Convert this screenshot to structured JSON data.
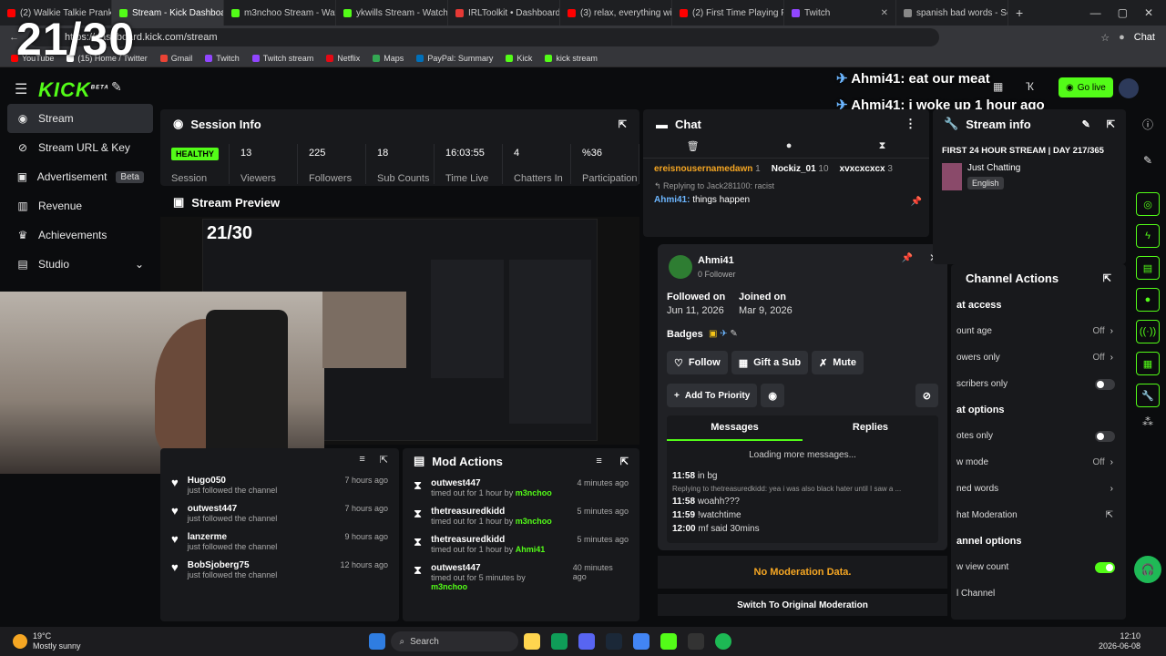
{
  "browser": {
    "tabs": [
      {
        "title": "(2) Walkie Talkie Prank",
        "color": "#ff0000"
      },
      {
        "title": "Stream - Kick Dashboard",
        "color": "#53fc18",
        "active": true
      },
      {
        "title": "m3nchoo Stream - Wat",
        "color": "#53fc18"
      },
      {
        "title": "ykwills Stream - Watch",
        "color": "#53fc18"
      },
      {
        "title": "IRLToolkit • Dashboard",
        "color": "#e53935"
      },
      {
        "title": "(3) relax, everything wil",
        "color": "#ff0000"
      },
      {
        "title": "(2) First Time Playing F",
        "color": "#ff0000"
      },
      {
        "title": "Twitch",
        "color": "#9146ff"
      },
      {
        "title": "spanish bad words - Se",
        "color": "#888888"
      }
    ],
    "url": "https://dashboard.kick.com/stream",
    "chat_label": "Chat",
    "bookmarks": [
      {
        "label": "YouTube",
        "color": "#ff0000"
      },
      {
        "label": "(15) Home / Twitter",
        "color": "#ffffff"
      },
      {
        "label": "Gmail",
        "color": "#ea4335"
      },
      {
        "label": "Twitch",
        "color": "#9146ff"
      },
      {
        "label": "Twitch stream",
        "color": "#9146ff"
      },
      {
        "label": "Netflix",
        "color": "#e50914"
      },
      {
        "label": "Maps",
        "color": "#34a853"
      },
      {
        "label": "PayPal: Summary",
        "color": "#0070ba"
      },
      {
        "label": "Kick",
        "color": "#53fc18"
      },
      {
        "label": "kick stream",
        "color": "#53fc18"
      }
    ]
  },
  "overlay": {
    "counter": "21/30",
    "chat1": "Ahmi41: eat our meat",
    "chat2": "Ahmi41: i woke up 1 hour ago",
    "go_live": "Go live",
    "preview_counter": "21/30"
  },
  "sidebar": {
    "logo": "KICK",
    "logo_badge": "BETA",
    "items": [
      {
        "label": "Stream",
        "icon": "stream-icon",
        "active": true
      },
      {
        "label": "Stream URL & Key",
        "icon": "link-icon"
      },
      {
        "label": "Advertisement",
        "icon": "ad-icon",
        "badge": "Beta"
      },
      {
        "label": "Revenue",
        "icon": "revenue-icon"
      },
      {
        "label": "Achievements",
        "icon": "trophy-icon"
      },
      {
        "label": "Studio",
        "icon": "studio-icon"
      }
    ]
  },
  "session": {
    "title": "Session Info",
    "status": "HEALTHY",
    "status_label": "Session",
    "stats": [
      {
        "value": "13",
        "label": "Viewers"
      },
      {
        "value": "225",
        "label": "Followers"
      },
      {
        "value": "18",
        "label": "Sub Counts"
      },
      {
        "value": "16:03:55",
        "label": "Time Live"
      },
      {
        "value": "4",
        "label": "Chatters In"
      },
      {
        "value": "%36",
        "label": "Participation"
      }
    ]
  },
  "preview": {
    "title": "Stream Preview"
  },
  "activity": [
    {
      "name": "Hugo050",
      "action": "just followed the channel",
      "time": "7 hours ago"
    },
    {
      "name": "outwest447",
      "action": "just followed the channel",
      "time": "7 hours ago"
    },
    {
      "name": "lanzerme",
      "action": "just followed the channel",
      "time": "9 hours ago"
    },
    {
      "name": "BobSjoberg75",
      "action": "just followed the channel",
      "time": "12 hours ago"
    }
  ],
  "mod_actions": {
    "title": "Mod Actions",
    "items": [
      {
        "name": "outwest447",
        "action": "timed out for 1 hour by",
        "by": "m3nchoo",
        "time": "4 minutes ago"
      },
      {
        "name": "thetreasuredkidd",
        "action": "timed out for 1 hour by",
        "by": "m3nchoo",
        "time": "5 minutes ago"
      },
      {
        "name": "thetreasuredkidd",
        "action": "timed out for 1 hour by",
        "by": "Ahmi41",
        "time": "5 minutes ago"
      },
      {
        "name": "outwest447",
        "action": "timed out for 5 minutes by",
        "by": "m3nchoo",
        "time": "40 minutes ago"
      }
    ]
  },
  "chat": {
    "title": "Chat",
    "top_chatters": [
      {
        "name": "ereisnousernamedawn",
        "count": "1"
      },
      {
        "name": "Nockiz_01",
        "count": "10"
      },
      {
        "name": "xvxcxcxcx",
        "count": "3"
      }
    ],
    "reply_line": "Replying to Jack281100: racist",
    "reply_line2": "Replying to Jack281100: racist",
    "message_user": "Ahmi41:",
    "message_text": "things happen",
    "partial_user": "Jack281100: racist"
  },
  "popup": {
    "username": "Ahmi41",
    "followers": "0 Follower",
    "followed_label": "Followed on",
    "followed_date": "Jun 11, 2026",
    "joined_label": "Joined on",
    "joined_date": "Mar 9, 2026",
    "badges_label": "Badges",
    "follow": "Follow",
    "gift": "Gift a Sub",
    "mute": "Mute",
    "priority": "Add To Priority",
    "tab_messages": "Messages",
    "tab_replies": "Replies",
    "loading": "Loading more messages...",
    "messages": [
      {
        "time": "11:58",
        "text": "in bg"
      },
      {
        "time": "",
        "text": "Replying to thetreasuredkidd: yea i was also black hater until I saw a ..."
      },
      {
        "time": "11:58",
        "text": "woahh???"
      },
      {
        "time": "11:59",
        "text": "!watchtime"
      },
      {
        "time": "12:00",
        "text": "mf said 30mins"
      }
    ],
    "no_mod": "No Moderation Data.",
    "switch": "Switch To Original Moderation"
  },
  "stream_info": {
    "title": "Stream info",
    "stream_title": "FIRST 24 HOUR STREAM | DAY 217/365",
    "category": "Just Chatting",
    "language": "English"
  },
  "channel_actions": {
    "title": "Channel Actions",
    "rows": [
      {
        "type": "header",
        "label": "at access"
      },
      {
        "type": "value",
        "label": "ount age",
        "value": "Off"
      },
      {
        "type": "value",
        "label": "owers only",
        "value": "Off"
      },
      {
        "type": "toggle",
        "label": "scribers only",
        "on": false
      },
      {
        "type": "header",
        "label": "at options"
      },
      {
        "type": "toggle",
        "label": "otes only",
        "on": false
      },
      {
        "type": "value",
        "label": "w mode",
        "value": "Off"
      },
      {
        "type": "arrow",
        "label": "ned words"
      },
      {
        "type": "link",
        "label": "hat Moderation"
      },
      {
        "type": "header",
        "label": "annel options"
      },
      {
        "type": "toggle",
        "label": "w view count",
        "on": true
      },
      {
        "type": "plain",
        "label": "l Channel"
      }
    ]
  },
  "taskbar": {
    "weather_temp": "19°C",
    "weather_desc": "Mostly sunny",
    "search": "Search",
    "time": "12:10",
    "date": "2026-06-08"
  }
}
